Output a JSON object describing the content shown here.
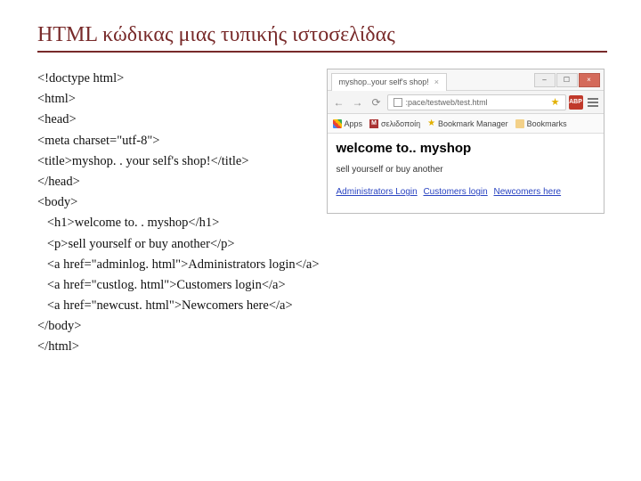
{
  "slide": {
    "title": "HTML κώδικας μιας τυπικής ιστοσελίδας"
  },
  "code": {
    "lines": [
      "<!doctype html>",
      "<html>",
      "<head>",
      "<meta charset=\"utf-8\">",
      "<title>myshop. . your self's shop!</title>",
      "</head>",
      "<body>",
      "   <h1>welcome to. . myshop</h1>",
      "   <p>sell yourself or buy another</p>",
      "   <a href=\"adminlog. html\">Administrators login</a>",
      "   <a href=\"custlog. html\">Customers login</a>",
      "   <a href=\"newcust. html\">Newcomers here</a>",
      "</body>",
      "</html>"
    ]
  },
  "browser": {
    "tab_title": "myshop..your self's shop!",
    "address": ":pace/testweb/test.html",
    "ext_label": "ABP",
    "bookmarks": {
      "apps": "Apps",
      "item2": "σελιδοποίη",
      "item3": "Bookmark Manager",
      "folder": "Bookmarks"
    },
    "page": {
      "heading": "welcome to.. myshop",
      "paragraph": "sell yourself or buy another",
      "links": {
        "admin": "Administrators Login",
        "customers": "Customers login",
        "newcomers": "Newcomers here"
      }
    }
  }
}
